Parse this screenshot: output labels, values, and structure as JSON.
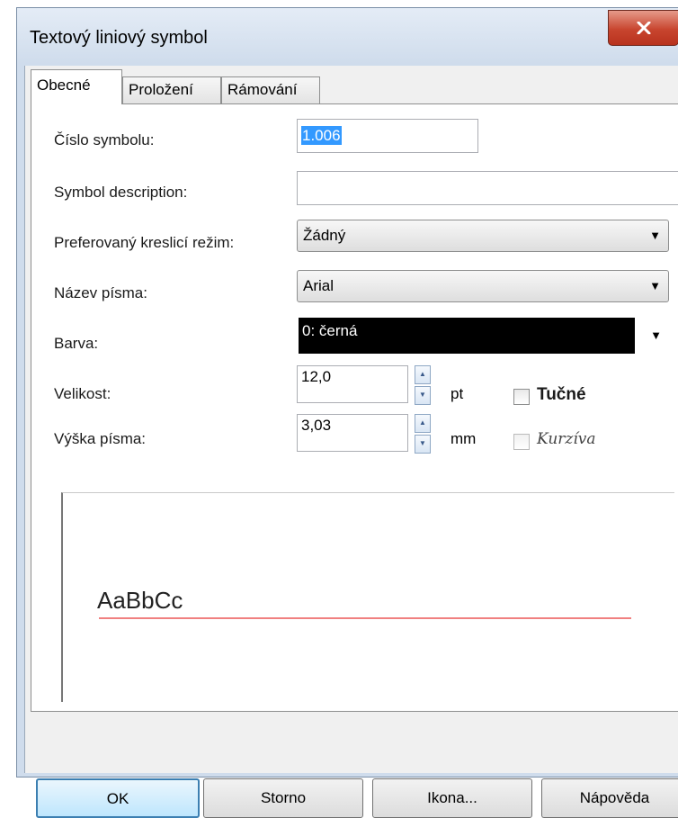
{
  "window": {
    "title": "Textový liniový symbol",
    "close_label": "X"
  },
  "tabs": [
    {
      "label": "Obecné",
      "active": true
    },
    {
      "label": "Proložení",
      "active": false
    },
    {
      "label": "Rámování",
      "active": false
    }
  ],
  "form": {
    "symbol_number": {
      "label": "Číslo symbolu:",
      "value": "1.006"
    },
    "symbol_description": {
      "label": "Symbol description:",
      "value": ""
    },
    "drawing_mode": {
      "label": "Preferovaný kreslicí režim:",
      "value": "Žádný"
    },
    "font_name": {
      "label": "Název písma:",
      "value": "Arial"
    },
    "color": {
      "label": "Barva:",
      "value": "0: černá",
      "swatch": "#000000"
    },
    "size": {
      "label": "Velikost:",
      "value": "12,0",
      "unit": "pt"
    },
    "font_height": {
      "label": "Výška písma:",
      "value": "3,03",
      "unit": "mm"
    },
    "bold": {
      "label": "Tučné",
      "checked": false
    },
    "italic": {
      "label": "Kurzíva",
      "checked": false
    }
  },
  "preview": {
    "text": "AaBbCc",
    "line_color": "#f08080"
  },
  "buttons": {
    "ok": "OK",
    "cancel": "Storno",
    "icon": "Ikona...",
    "help": "Nápověda"
  }
}
